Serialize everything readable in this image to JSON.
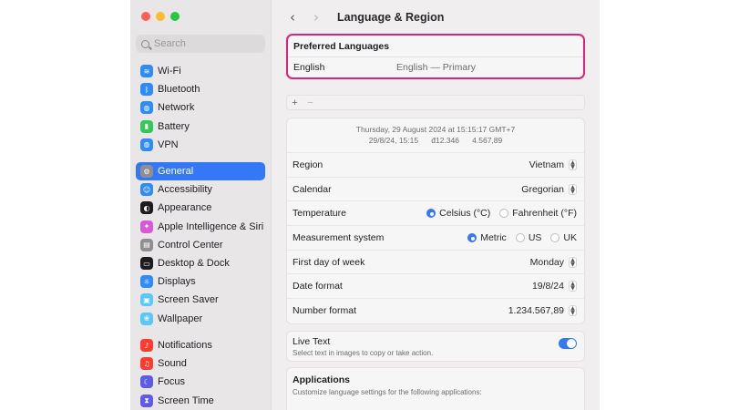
{
  "window": {
    "title": "Language & Region"
  },
  "sidebar": {
    "search_placeholder": "Search",
    "group1": [
      {
        "label": "Wi-Fi",
        "icon": "wifi-icon",
        "color": "#2f8cf7",
        "glyph": "≋"
      },
      {
        "label": "Bluetooth",
        "icon": "bluetooth-icon",
        "color": "#2f8cf7",
        "glyph": "ᛒ"
      },
      {
        "label": "Network",
        "icon": "globe-icon",
        "color": "#2f8cf7",
        "glyph": "◍"
      },
      {
        "label": "Battery",
        "icon": "battery-icon",
        "color": "#34c759",
        "glyph": "▮"
      },
      {
        "label": "VPN",
        "icon": "vpn-icon",
        "color": "#2f8cf7",
        "glyph": "◍"
      }
    ],
    "group2": [
      {
        "label": "General",
        "icon": "gear-icon",
        "color": "#8e8e93",
        "glyph": "⚙",
        "active": true
      },
      {
        "label": "Accessibility",
        "icon": "accessibility-icon",
        "color": "#2f8cf7",
        "glyph": "☺"
      },
      {
        "label": "Appearance",
        "icon": "appearance-icon",
        "color": "#1d1d1f",
        "glyph": "◐"
      },
      {
        "label": "Apple Intelligence & Siri",
        "icon": "siri-icon",
        "color": "#d65ad6",
        "glyph": "✦"
      },
      {
        "label": "Control Center",
        "icon": "control-center-icon",
        "color": "#8e8e93",
        "glyph": "▤"
      },
      {
        "label": "Desktop & Dock",
        "icon": "dock-icon",
        "color": "#1d1d1f",
        "glyph": "▭"
      },
      {
        "label": "Displays",
        "icon": "displays-icon",
        "color": "#2f8cf7",
        "glyph": "☼"
      },
      {
        "label": "Screen Saver",
        "icon": "screen-saver-icon",
        "color": "#5ac8fa",
        "glyph": "▣"
      },
      {
        "label": "Wallpaper",
        "icon": "wallpaper-icon",
        "color": "#5ac8fa",
        "glyph": "❀"
      }
    ],
    "group3": [
      {
        "label": "Notifications",
        "icon": "bell-icon",
        "color": "#ff3b30",
        "glyph": "♪"
      },
      {
        "label": "Sound",
        "icon": "speaker-icon",
        "color": "#ff3b30",
        "glyph": "♫"
      },
      {
        "label": "Focus",
        "icon": "moon-icon",
        "color": "#5e5ce6",
        "glyph": "☾"
      },
      {
        "label": "Screen Time",
        "icon": "hourglass-icon",
        "color": "#5e5ce6",
        "glyph": "⧗"
      }
    ]
  },
  "preferred_languages": {
    "header": "Preferred Languages",
    "language": "English",
    "detail": "English — Primary",
    "add_label": "+",
    "remove_label": "−"
  },
  "region_settings": {
    "preview_line1": "Thursday, 29 August 2024 at 15:15:17 GMT+7",
    "preview_line2": "29/8/24, 15:15      đ12.346      4.567,89",
    "region": {
      "label": "Region",
      "value": "Vietnam"
    },
    "calendar": {
      "label": "Calendar",
      "value": "Gregorian"
    },
    "temperature": {
      "label": "Temperature",
      "options": [
        "Celsius (°C)",
        "Fahrenheit (°F)"
      ],
      "selected": "Celsius (°C)"
    },
    "measurement": {
      "label": "Measurement system",
      "options": [
        "Metric",
        "US",
        "UK"
      ],
      "selected": "Metric"
    },
    "first_day": {
      "label": "First day of week",
      "value": "Monday"
    },
    "date_format": {
      "label": "Date format",
      "value": "19/8/24"
    },
    "number_format": {
      "label": "Number format",
      "value": "1.234.567,89"
    }
  },
  "live_text": {
    "title": "Live Text",
    "subtitle": "Select text in images to copy or take action.",
    "enabled": true
  },
  "applications": {
    "title": "Applications",
    "subtitle": "Customize language settings for the following applications:"
  }
}
